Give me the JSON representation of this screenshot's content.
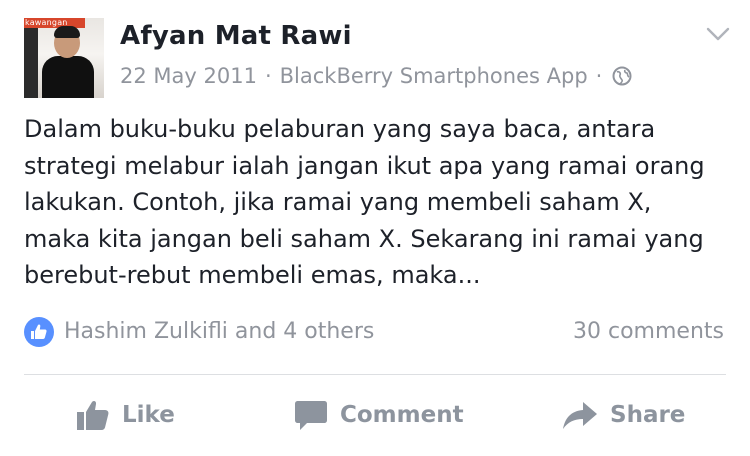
{
  "post": {
    "author": {
      "name": "Afyan Mat Rawi",
      "avatar_watermark": "kawangan"
    },
    "meta": {
      "date": "22 May 2011",
      "separator": "·",
      "source": "BlackBerry Smartphones App",
      "privacy_icon": "globe-icon"
    },
    "menu_icon": "chevron-down-icon",
    "body_text": "Dalam buku-buku pelaburan yang saya baca, antara strategi melabur ialah jangan ikut apa yang ramai orang lakukan. Contoh, jika ramai yang membeli saham X, maka kita jangan beli saham X. Sekarang ini ramai yang berebut-rebut membeli emas, maka...",
    "summary": {
      "reaction_icon": "like-icon",
      "likers_text": "Hashim Zulkifli and 4 others",
      "comments_text": "30 comments"
    },
    "actions": [
      {
        "label": "Like",
        "icon": "thumbs-up-icon"
      },
      {
        "label": "Comment",
        "icon": "speech-bubble-icon"
      },
      {
        "label": "Share",
        "icon": "share-arrow-icon"
      }
    ],
    "colors": {
      "text": "#1d2129",
      "muted": "#90949c",
      "action": "#8d949e",
      "like_badge": "#5890ff",
      "divider": "#dddfe2"
    }
  }
}
